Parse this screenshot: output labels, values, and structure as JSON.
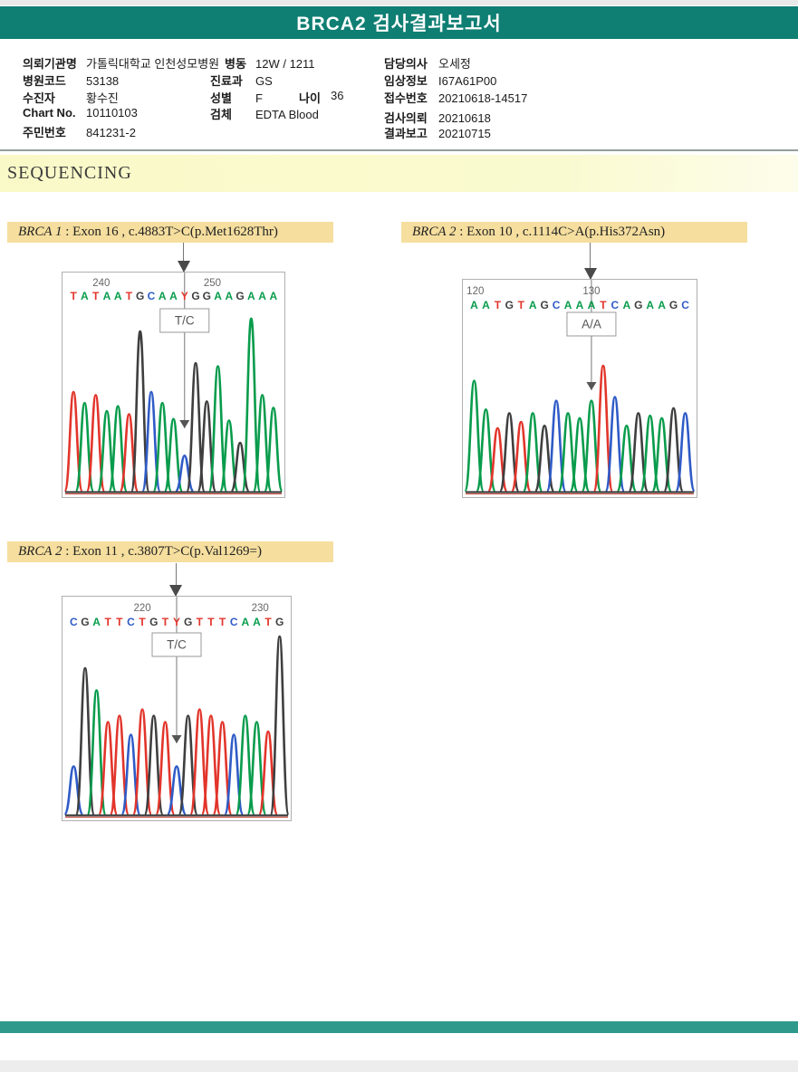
{
  "header": {
    "title": "BRCA2 검사결과보고서"
  },
  "section_title": "SEQUENCING",
  "patient_info": {
    "colA": [
      {
        "label": "의뢰기관명",
        "value": "가톨릭대학교 인천성모병원"
      },
      {
        "label": "병원코드",
        "value": "53138"
      },
      {
        "label": "수진자",
        "value": "황수진"
      },
      {
        "label": "Chart No.",
        "value": "10110103"
      },
      {
        "label": "주민번호",
        "value": "841231-2"
      }
    ],
    "colB": [
      {
        "label": "병동",
        "value": "12W / 1211"
      },
      {
        "label": "진료과",
        "value": "GS"
      },
      {
        "label": "성별",
        "value": "F",
        "label2": "나이",
        "value2": "36"
      },
      {
        "label": "검체",
        "value": "EDTA Blood"
      }
    ],
    "colC": [
      {
        "label": "담당의사",
        "value": "오세정"
      },
      {
        "label": "임상정보",
        "value": "I67A61P00"
      },
      {
        "label": "접수번호",
        "value": "20210618-14517"
      },
      {
        "label": "검사의뢰",
        "value": "20210618"
      },
      {
        "label": "결과보고",
        "value": "20210715"
      }
    ]
  },
  "colors": {
    "header_teal": "#0f7e73",
    "footer_teal": "#2f9a8c",
    "sequencing_band": "#f9f9c8",
    "panel_label_band": "#f5de9e",
    "base_A": "#089c4c",
    "base_T": "#e2352b",
    "base_G": "#3f3f3f",
    "base_C": "#2f5bc7",
    "base_Y_letter": "#e2352b",
    "base_Y_peak": "#2f5bc7"
  },
  "chart_data": [
    {
      "type": "line",
      "title": "BRCA 1 : Exon 16 , c.4883T>C(p.Met1628Thr)",
      "x": "base position 240-250",
      "series_note": "Sanger trace peak heights per base",
      "sequence": "TATAATGCAAYGGAAGAAA",
      "values": [
        0.62,
        0.55,
        0.6,
        0.5,
        0.53,
        0.48,
        1.0,
        0.62,
        0.55,
        0.45,
        0.22,
        0.8,
        0.56,
        0.78,
        0.44,
        0.3,
        1.08,
        0.6,
        0.52
      ]
    },
    {
      "type": "line",
      "title": "BRCA 2 : Exon 10 , c.1114C>A(p.His372Asn)",
      "x": "base position 120-130",
      "series_note": "Sanger trace peak heights per base",
      "sequence": "AATGTAGCAAATCAGAAGC",
      "values": [
        0.88,
        0.65,
        0.5,
        0.62,
        0.55,
        0.62,
        0.52,
        0.72,
        0.62,
        0.58,
        0.72,
        1.0,
        0.75,
        0.52,
        0.62,
        0.6,
        0.58,
        0.66,
        0.62
      ]
    },
    {
      "type": "line",
      "title": "BRCA 2 : Exon 11 , c.3807T>C(p.Val1269=)",
      "x": "base position 220-230",
      "series_note": "Sanger trace peak heights per base",
      "sequence": "CGATTCTGTYGTTTCAATG",
      "values": [
        0.3,
        0.92,
        0.78,
        0.58,
        0.62,
        0.5,
        0.66,
        0.62,
        0.58,
        0.3,
        0.62,
        0.66,
        0.62,
        0.58,
        0.5,
        0.62,
        0.58,
        0.52,
        1.12
      ]
    }
  ],
  "panels": [
    {
      "label_gene": "BRCA 1",
      "label_rest": " : Exon 16 , c.4883T>C(p.Met1628Thr)",
      "genotype": "T/C",
      "variant_index": 10,
      "sequence": "TATAATGCAAYGGAAGAAA",
      "heights": [
        0.62,
        0.55,
        0.6,
        0.5,
        0.53,
        0.48,
        1.0,
        0.62,
        0.55,
        0.45,
        0.22,
        0.8,
        0.56,
        0.78,
        0.44,
        0.3,
        1.08,
        0.6,
        0.52
      ],
      "ruler": [
        {
          "text": "240",
          "idx": 2.5
        },
        {
          "text": "250",
          "idx": 12.5
        }
      ]
    },
    {
      "label_gene": "BRCA 2",
      "label_rest": " : Exon 10 , c.1114C>A(p.His372Asn)",
      "genotype": "A/A",
      "variant_index": 10,
      "sequence": "AATGTAGCAAATCAGAAGC",
      "heights": [
        0.88,
        0.65,
        0.5,
        0.62,
        0.55,
        0.62,
        0.52,
        0.72,
        0.62,
        0.58,
        0.72,
        1.0,
        0.75,
        0.52,
        0.62,
        0.6,
        0.58,
        0.66,
        0.62
      ],
      "ruler": [
        {
          "text": "120",
          "idx": 0.1
        },
        {
          "text": "130",
          "idx": 10
        }
      ]
    },
    {
      "label_gene": "BRCA 2",
      "label_rest": " : Exon 11 , c.3807T>C(p.Val1269=)",
      "genotype": "T/C",
      "variant_index": 9,
      "sequence": "CGATTCTGTYGTTTCAATG",
      "heights": [
        0.3,
        0.92,
        0.78,
        0.58,
        0.62,
        0.5,
        0.66,
        0.62,
        0.58,
        0.3,
        0.62,
        0.66,
        0.62,
        0.58,
        0.5,
        0.62,
        0.58,
        0.52,
        1.12
      ],
      "ruler": [
        {
          "text": "220",
          "idx": 6
        },
        {
          "text": "230",
          "idx": 16.3
        }
      ]
    }
  ]
}
